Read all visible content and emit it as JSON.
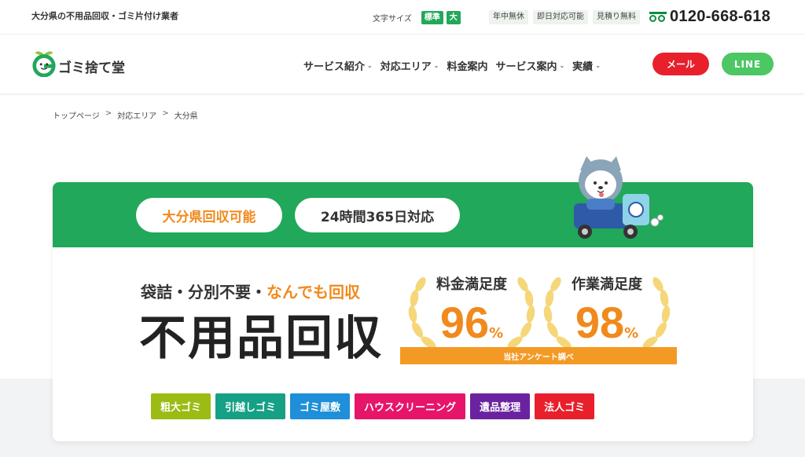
{
  "topbar": {
    "tagline": "大分県の不用品回収・ゴミ片付け業者",
    "font_size_label": "文字サイズ",
    "font_size_options": [
      "標準",
      "大"
    ],
    "tags": [
      "年中無休",
      "即日対応可能",
      "見積り無料"
    ],
    "phone": "0120-668-618"
  },
  "header": {
    "logo_text": "ゴミ捨て堂",
    "nav": [
      {
        "label": "サービス紹介",
        "has_dropdown": true
      },
      {
        "label": "対応エリア",
        "has_dropdown": true
      },
      {
        "label": "料金案内",
        "has_dropdown": false
      },
      {
        "label": "サービス案内",
        "has_dropdown": true
      },
      {
        "label": "実績",
        "has_dropdown": true
      }
    ],
    "chevron": "⌄",
    "mail_button": "メール",
    "line_button": "LINE"
  },
  "breadcrumb": {
    "items": [
      "トップページ",
      "対応エリア",
      "大分県"
    ],
    "separator": ">"
  },
  "hero": {
    "pill_area": "大分県回収可能",
    "pill_hours": "24時間365日対応",
    "sub_copy_prefix": "袋詰・分別不要・",
    "sub_copy_accent": "なんでも回収",
    "main_copy": "不用品回収",
    "satisfaction": [
      {
        "title": "料金満足度",
        "value": "96",
        "unit": "%"
      },
      {
        "title": "作業満足度",
        "value": "98",
        "unit": "%"
      }
    ],
    "survey_note": "当社アンケート調べ",
    "categories": [
      {
        "label": "粗大ゴミ",
        "color": "#9bbc14"
      },
      {
        "label": "引越しゴミ",
        "color": "#16a085"
      },
      {
        "label": "ゴミ屋敷",
        "color": "#1e8fd8"
      },
      {
        "label": "ハウスクリーニング",
        "color": "#e6156a"
      },
      {
        "label": "遺品整理",
        "color": "#6a22a0"
      },
      {
        "label": "法人ゴミ",
        "color": "#e8202c"
      }
    ]
  },
  "colors": {
    "brand_green": "#21a85a",
    "accent_orange": "#f08a1c",
    "mail_red": "#e8202c",
    "line_green": "#4cc764"
  }
}
